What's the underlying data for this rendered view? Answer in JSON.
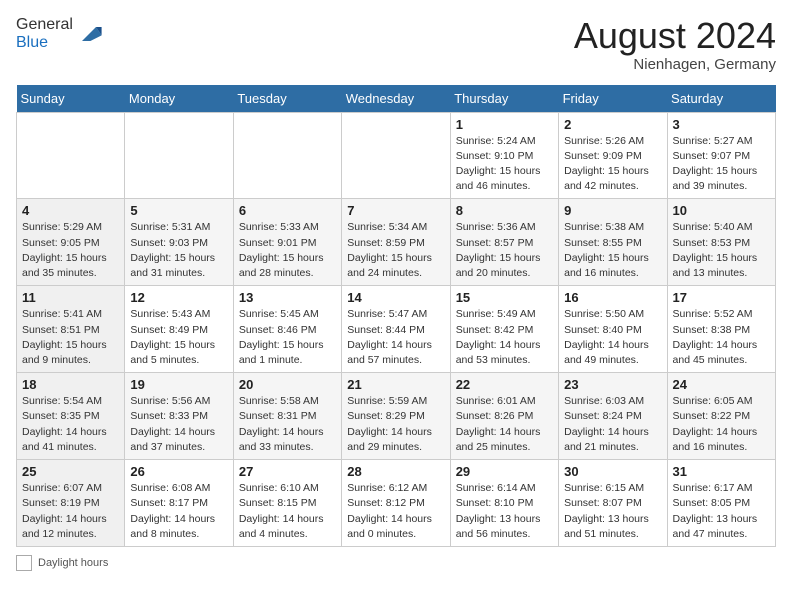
{
  "header": {
    "logo_line1": "General",
    "logo_line2": "Blue",
    "month_year": "August 2024",
    "location": "Nienhagen, Germany"
  },
  "days_of_week": [
    "Sunday",
    "Monday",
    "Tuesday",
    "Wednesday",
    "Thursday",
    "Friday",
    "Saturday"
  ],
  "legend": {
    "label": "Daylight hours"
  },
  "weeks": [
    [
      {
        "num": "",
        "info": ""
      },
      {
        "num": "",
        "info": ""
      },
      {
        "num": "",
        "info": ""
      },
      {
        "num": "",
        "info": ""
      },
      {
        "num": "1",
        "info": "Sunrise: 5:24 AM\nSunset: 9:10 PM\nDaylight: 15 hours\nand 46 minutes."
      },
      {
        "num": "2",
        "info": "Sunrise: 5:26 AM\nSunset: 9:09 PM\nDaylight: 15 hours\nand 42 minutes."
      },
      {
        "num": "3",
        "info": "Sunrise: 5:27 AM\nSunset: 9:07 PM\nDaylight: 15 hours\nand 39 minutes."
      }
    ],
    [
      {
        "num": "4",
        "info": "Sunrise: 5:29 AM\nSunset: 9:05 PM\nDaylight: 15 hours\nand 35 minutes."
      },
      {
        "num": "5",
        "info": "Sunrise: 5:31 AM\nSunset: 9:03 PM\nDaylight: 15 hours\nand 31 minutes."
      },
      {
        "num": "6",
        "info": "Sunrise: 5:33 AM\nSunset: 9:01 PM\nDaylight: 15 hours\nand 28 minutes."
      },
      {
        "num": "7",
        "info": "Sunrise: 5:34 AM\nSunset: 8:59 PM\nDaylight: 15 hours\nand 24 minutes."
      },
      {
        "num": "8",
        "info": "Sunrise: 5:36 AM\nSunset: 8:57 PM\nDaylight: 15 hours\nand 20 minutes."
      },
      {
        "num": "9",
        "info": "Sunrise: 5:38 AM\nSunset: 8:55 PM\nDaylight: 15 hours\nand 16 minutes."
      },
      {
        "num": "10",
        "info": "Sunrise: 5:40 AM\nSunset: 8:53 PM\nDaylight: 15 hours\nand 13 minutes."
      }
    ],
    [
      {
        "num": "11",
        "info": "Sunrise: 5:41 AM\nSunset: 8:51 PM\nDaylight: 15 hours\nand 9 minutes."
      },
      {
        "num": "12",
        "info": "Sunrise: 5:43 AM\nSunset: 8:49 PM\nDaylight: 15 hours\nand 5 minutes."
      },
      {
        "num": "13",
        "info": "Sunrise: 5:45 AM\nSunset: 8:46 PM\nDaylight: 15 hours\nand 1 minute."
      },
      {
        "num": "14",
        "info": "Sunrise: 5:47 AM\nSunset: 8:44 PM\nDaylight: 14 hours\nand 57 minutes."
      },
      {
        "num": "15",
        "info": "Sunrise: 5:49 AM\nSunset: 8:42 PM\nDaylight: 14 hours\nand 53 minutes."
      },
      {
        "num": "16",
        "info": "Sunrise: 5:50 AM\nSunset: 8:40 PM\nDaylight: 14 hours\nand 49 minutes."
      },
      {
        "num": "17",
        "info": "Sunrise: 5:52 AM\nSunset: 8:38 PM\nDaylight: 14 hours\nand 45 minutes."
      }
    ],
    [
      {
        "num": "18",
        "info": "Sunrise: 5:54 AM\nSunset: 8:35 PM\nDaylight: 14 hours\nand 41 minutes."
      },
      {
        "num": "19",
        "info": "Sunrise: 5:56 AM\nSunset: 8:33 PM\nDaylight: 14 hours\nand 37 minutes."
      },
      {
        "num": "20",
        "info": "Sunrise: 5:58 AM\nSunset: 8:31 PM\nDaylight: 14 hours\nand 33 minutes."
      },
      {
        "num": "21",
        "info": "Sunrise: 5:59 AM\nSunset: 8:29 PM\nDaylight: 14 hours\nand 29 minutes."
      },
      {
        "num": "22",
        "info": "Sunrise: 6:01 AM\nSunset: 8:26 PM\nDaylight: 14 hours\nand 25 minutes."
      },
      {
        "num": "23",
        "info": "Sunrise: 6:03 AM\nSunset: 8:24 PM\nDaylight: 14 hours\nand 21 minutes."
      },
      {
        "num": "24",
        "info": "Sunrise: 6:05 AM\nSunset: 8:22 PM\nDaylight: 14 hours\nand 16 minutes."
      }
    ],
    [
      {
        "num": "25",
        "info": "Sunrise: 6:07 AM\nSunset: 8:19 PM\nDaylight: 14 hours\nand 12 minutes."
      },
      {
        "num": "26",
        "info": "Sunrise: 6:08 AM\nSunset: 8:17 PM\nDaylight: 14 hours\nand 8 minutes."
      },
      {
        "num": "27",
        "info": "Sunrise: 6:10 AM\nSunset: 8:15 PM\nDaylight: 14 hours\nand 4 minutes."
      },
      {
        "num": "28",
        "info": "Sunrise: 6:12 AM\nSunset: 8:12 PM\nDaylight: 14 hours\nand 0 minutes."
      },
      {
        "num": "29",
        "info": "Sunrise: 6:14 AM\nSunset: 8:10 PM\nDaylight: 13 hours\nand 56 minutes."
      },
      {
        "num": "30",
        "info": "Sunrise: 6:15 AM\nSunset: 8:07 PM\nDaylight: 13 hours\nand 51 minutes."
      },
      {
        "num": "31",
        "info": "Sunrise: 6:17 AM\nSunset: 8:05 PM\nDaylight: 13 hours\nand 47 minutes."
      }
    ]
  ]
}
